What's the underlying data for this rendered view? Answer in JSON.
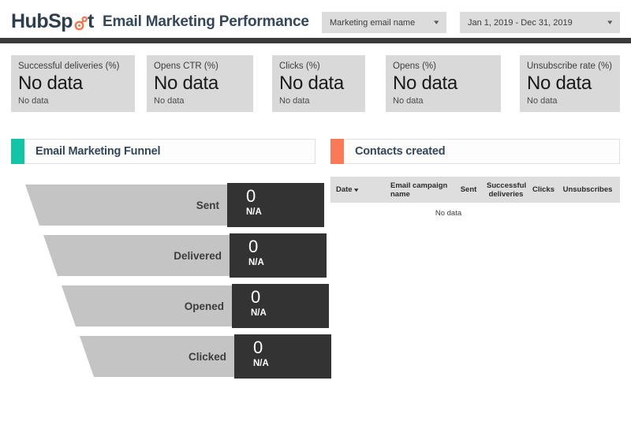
{
  "header": {
    "logo_text_left": "HubSp",
    "logo_text_right": "t",
    "logo_icon": "hubspot-sprocket-icon",
    "title": "Email Marketing Performance",
    "filters": [
      {
        "name": "marketing-email-name",
        "value": "Marketing email name",
        "caret": "▾"
      },
      {
        "name": "date-range",
        "value": "Jan 1, 2019 - Dec 31, 2019",
        "caret": "▾"
      }
    ]
  },
  "kpis": [
    {
      "title": "Successful deliveries (%)",
      "value": "No data",
      "sub": "No data"
    },
    {
      "title": "Opens CTR (%)",
      "value": "No data",
      "sub": "No data"
    },
    {
      "title": "Clicks (%)",
      "value": "No data",
      "sub": "No data"
    },
    {
      "title": "Opens (%)",
      "value": "No data",
      "sub": "No data"
    },
    {
      "title": "Unsubscribe rate (%)",
      "value": "No data",
      "sub": "No data"
    }
  ],
  "funnel_panel": {
    "title": "Email Marketing Funnel",
    "accent_color": "#13c4a5"
  },
  "contacts_panel": {
    "title": "Contacts created",
    "accent_color": "#fa7a57"
  },
  "chart_data": {
    "type": "bar",
    "title": "Email Marketing Funnel",
    "xlabel": "",
    "ylabel": "",
    "categories": [
      "Sent",
      "Delivered",
      "Opened",
      "Clicked"
    ],
    "values": [
      0,
      0,
      0,
      0
    ],
    "value_labels": [
      "0",
      "0",
      "0",
      "0"
    ],
    "rate_labels": [
      "N/A",
      "N/A",
      "N/A",
      "N/A"
    ],
    "grid": false,
    "legend": "none",
    "note": "Funnel with no data; all stage counts are 0 and conversion rates are N/A."
  },
  "funnel_stages": [
    {
      "label": "Sent",
      "count": "0",
      "rate": "N/A"
    },
    {
      "label": "Delivered",
      "count": "0",
      "rate": "N/A"
    },
    {
      "label": "Opened",
      "count": "0",
      "rate": "N/A"
    },
    {
      "label": "Clicked",
      "count": "0",
      "rate": "N/A"
    }
  ],
  "contacts_table": {
    "columns": [
      {
        "label": "Date",
        "sortable": true,
        "sort_caret": "▾"
      },
      {
        "label": "Email campaign name",
        "sortable": false
      },
      {
        "label": "Sent",
        "sortable": false
      },
      {
        "label": "Successful deliveries",
        "sortable": false
      },
      {
        "label": "Clicks",
        "sortable": false
      },
      {
        "label": "Unsubscribes",
        "sortable": false
      }
    ],
    "rows": [],
    "empty_text": "No data"
  }
}
